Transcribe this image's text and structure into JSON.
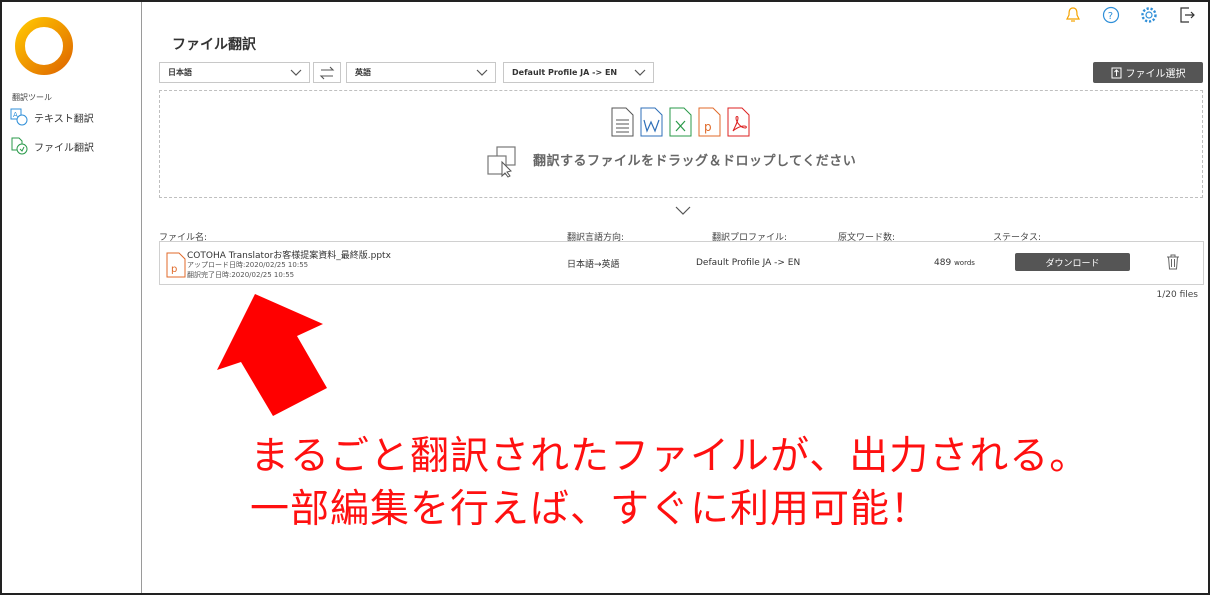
{
  "sidebar": {
    "tools_label": "翻訳ツール",
    "items": [
      {
        "label": "テキスト翻訳",
        "icon": "text-translate-icon"
      },
      {
        "label": "ファイル翻訳",
        "icon": "file-translate-icon"
      }
    ],
    "logo_colors": [
      "#f5a300",
      "#e07000"
    ]
  },
  "header": {
    "icons": [
      "bell-icon",
      "help-icon",
      "gear-icon",
      "logout-icon"
    ],
    "accent_color": "#2f8fd8",
    "bell_color": "#f5a300"
  },
  "main": {
    "title": "ファイル翻訳",
    "source_language": "日本語",
    "target_language": "英語",
    "profile": "Default Profile JA -> EN",
    "upload_button": "ファイル選択",
    "drop_text": "翻訳するファイルをドラッグ＆ドロップしてください",
    "file_type_icons": [
      "txt-icon",
      "word-icon",
      "excel-icon",
      "powerpoint-icon",
      "pdf-icon"
    ]
  },
  "table": {
    "headers": {
      "file_name": "ファイル名:",
      "direction": "翻訳言語方向:",
      "profile": "翻訳プロファイル:",
      "word_count": "原文ワード数:",
      "status": "ステータス:"
    },
    "rows": [
      {
        "file_name": "COTOHA Translatorお客様提案資料_最終版.pptx",
        "uploaded": "アップロード日時:2020/02/25 10:55",
        "completed": "翻訳完了日時:2020/02/25 10:55",
        "direction": "日本語→英語",
        "profile": "Default Profile JA -> EN",
        "words": "489",
        "words_unit": "words",
        "action": "ダウンロード"
      }
    ],
    "count": "1/20 files"
  },
  "annotation": {
    "line1": "まるごと翻訳されたファイルが、出力される。",
    "line2": "一部編集を行えば、すぐに利用可能！",
    "color": "#ff1010"
  }
}
